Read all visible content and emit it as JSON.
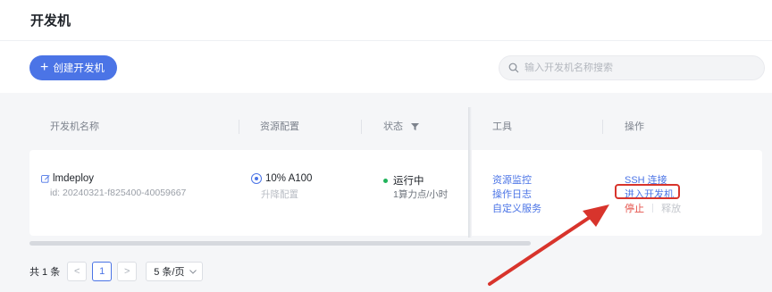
{
  "page": {
    "title": "开发机"
  },
  "toolbar": {
    "create_label": "创建开发机",
    "search_placeholder": "输入开发机名称搜索"
  },
  "table": {
    "columns": [
      "开发机名称",
      "资源配置",
      "状态",
      "工具",
      "操作"
    ],
    "rows": [
      {
        "name": "lmdeploy",
        "id": "id: 20240321-f825400-40059667",
        "resource": "10% A100",
        "resource_action": "升降配置",
        "status": "运行中",
        "status_detail": "1算力点/小时",
        "tools": [
          "资源监控",
          "操作日志",
          "自定义服务"
        ],
        "actions": {
          "ssh": "SSH 连接",
          "enter": "进入开发机",
          "stop": "停止",
          "release": "释放"
        }
      }
    ]
  },
  "pagination": {
    "total": "共 1 条",
    "prev": "<",
    "page": "1",
    "next": ">",
    "page_size": "5 条/页"
  },
  "colors": {
    "accent": "#4b74e6",
    "running": "#21b35b",
    "danger": "#e5534b",
    "annotation": "#d8342c"
  },
  "icons": [
    "plus-icon",
    "search-icon",
    "filter-icon",
    "edit-icon",
    "gpu-icon",
    "chevron-down-icon",
    "annotation-arrow"
  ]
}
